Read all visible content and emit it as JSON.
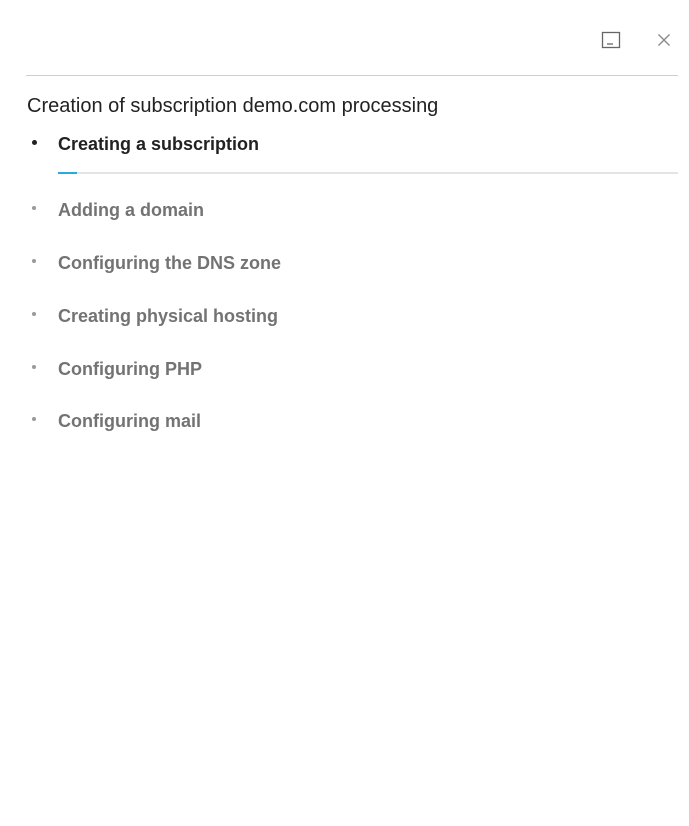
{
  "dialog": {
    "title": "Creation of subscription demo.com processing",
    "icons": {
      "minimize": "minimize-icon",
      "close": "close-icon"
    }
  },
  "steps": [
    {
      "label": "Creating a subscription",
      "status": "in-progress"
    },
    {
      "label": "Adding a domain",
      "status": "pending"
    },
    {
      "label": "Configuring the DNS zone",
      "status": "pending"
    },
    {
      "label": "Creating physical hosting",
      "status": "pending"
    },
    {
      "label": "Configuring PHP",
      "status": "pending"
    },
    {
      "label": "Configuring mail",
      "status": "pending"
    }
  ],
  "progress": {
    "current_step_fraction": 0.03
  },
  "colors": {
    "accent": "#28aade",
    "active_text": "#222222",
    "pending_text": "#737373",
    "divider": "#cdcdcd"
  }
}
